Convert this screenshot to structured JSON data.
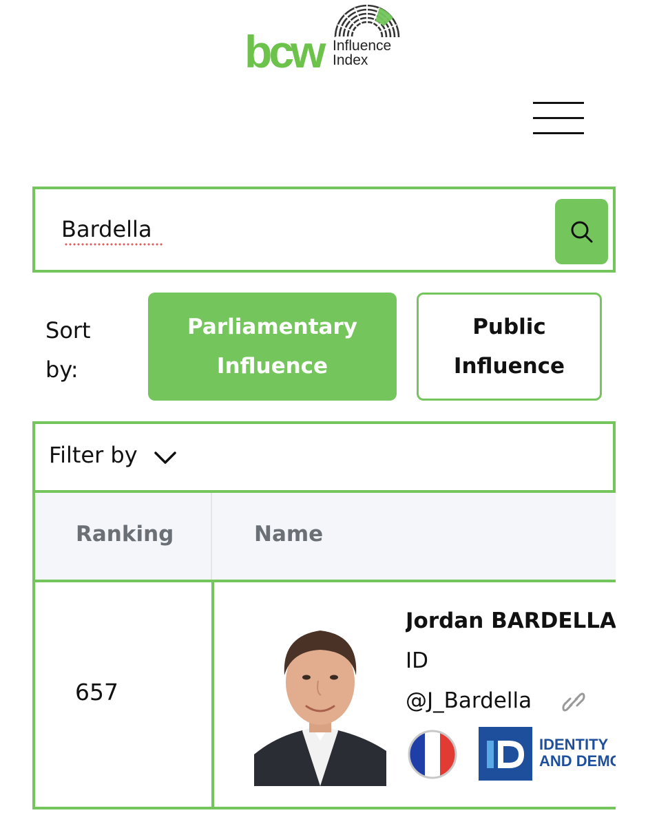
{
  "header": {
    "logo_brand": "bcw",
    "logo_line1": "Influence",
    "logo_line2": "Index",
    "brand_color": "#6cc24a"
  },
  "menu": {
    "icon": "hamburger-menu-icon"
  },
  "search": {
    "value": "Bardella",
    "button_icon": "search-icon"
  },
  "sort": {
    "label": "Sort by:",
    "options": [
      {
        "label": "Parliamentary Influence",
        "active": true
      },
      {
        "label": "Public Influence",
        "active": false
      }
    ]
  },
  "filter": {
    "label": "Filter by",
    "icon": "chevron-down-icon"
  },
  "table": {
    "columns": [
      "Ranking",
      "Name"
    ],
    "rows": [
      {
        "ranking": "657",
        "name": "Jordan BARDELLA",
        "group": "ID",
        "handle": "@J_Bardella",
        "country_flag": "france-flag",
        "party_logo_text": [
          "IDENTITY",
          "AND DEMOCRACY"
        ]
      }
    ]
  },
  "colors": {
    "accent": "#74c65c",
    "header_bg": "#f5f6f9",
    "party_blue": "#1d4f9c"
  }
}
